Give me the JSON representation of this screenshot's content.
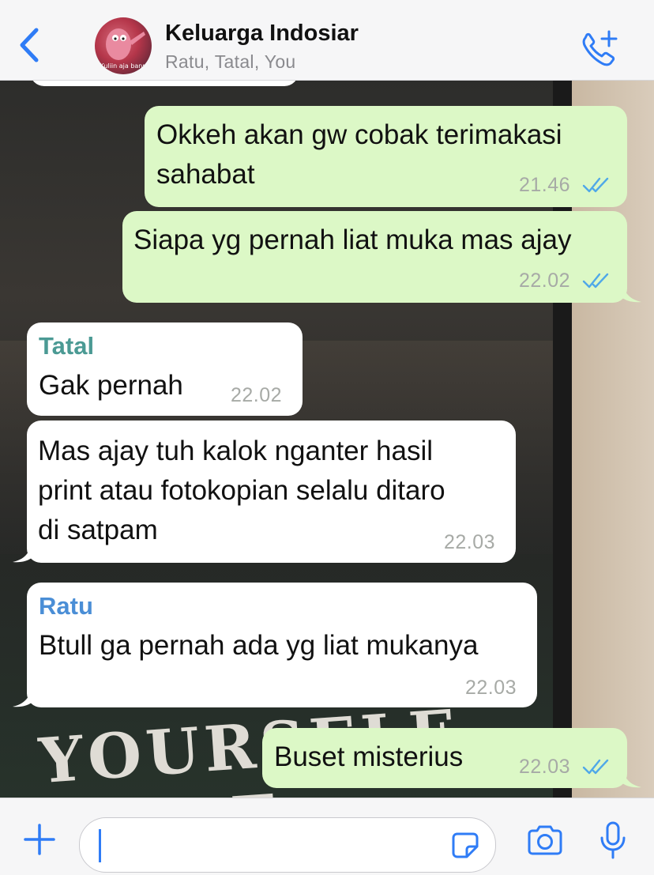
{
  "header": {
    "title": "Keluarga Indosiar",
    "participants": "Ratu, Tatal, You",
    "avatar_caption": "Kuliin aja bann",
    "accent_color": "#2f7cf6"
  },
  "messages": [
    {
      "direction": "out",
      "lines": [
        "Okkeh akan gw cobak terimakasi",
        "sahabat"
      ],
      "time": "21.46",
      "status": "read"
    },
    {
      "direction": "out",
      "lines": [
        "Siapa yg pernah liat muka mas ajay"
      ],
      "time": "22.02",
      "status": "read"
    },
    {
      "direction": "in",
      "sender": "Tatal",
      "sender_color": "#4b9a94",
      "lines": [
        "Gak pernah"
      ],
      "time": "22.02"
    },
    {
      "direction": "in",
      "lines": [
        "Mas ajay tuh kalok nganter hasil",
        "print atau fotokopian selalu ditaro",
        "di satpam"
      ],
      "time": "22.03"
    },
    {
      "direction": "in",
      "sender": "Ratu",
      "sender_color": "#4a8ed6",
      "lines": [
        "Btull ga pernah ada yg liat mukanya"
      ],
      "time": "22.03"
    },
    {
      "direction": "out",
      "lines": [
        "Buset misterius"
      ],
      "time": "22.03",
      "status": "read"
    }
  ],
  "wallpaper_text": "YOURSELF MORE",
  "composer": {
    "text": "",
    "icons": [
      "plus-icon",
      "sticker-icon",
      "camera-icon",
      "microphone-icon"
    ]
  }
}
